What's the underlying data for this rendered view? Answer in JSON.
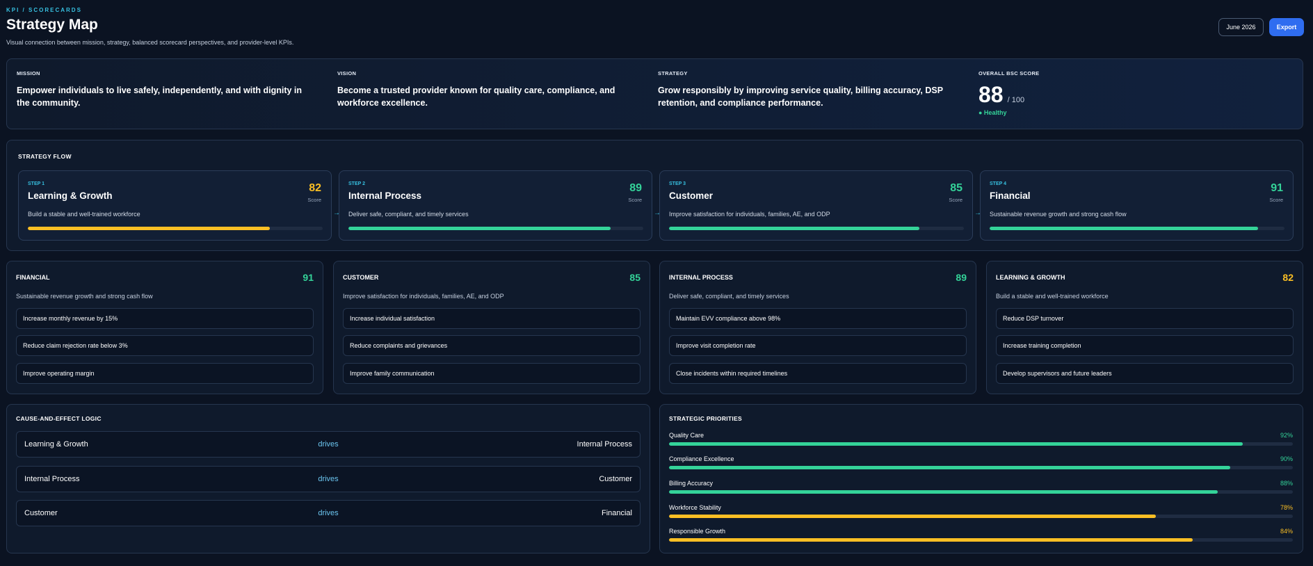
{
  "header": {
    "breadcrumb": "KPI / SCORECARDS",
    "title": "Strategy Map",
    "subtitle": "Visual connection between mission, strategy, balanced scorecard perspectives, and provider-level KPIs.",
    "date_button": "June 2026",
    "export_button": "Export"
  },
  "mission": {
    "mission_label": "MISSION",
    "mission_text": "Empower individuals to live safely, independently, and with dignity in the community.",
    "vision_label": "VISION",
    "vision_text": "Become a trusted provider known for quality care, compliance, and workforce excellence.",
    "strategy_label": "STRATEGY",
    "strategy_text": "Grow responsibly by improving service quality, billing accuracy, DSP retention, and compliance performance.",
    "score_label": "OVERALL BSC SCORE",
    "score_value": "88",
    "score_max": "/ 100",
    "score_status": "● Healthy"
  },
  "flow": {
    "label": "STRATEGY FLOW",
    "steps": [
      {
        "tag": "STEP 1",
        "name": "Learning & Growth",
        "score": "82",
        "score_label": "Score",
        "desc": "Build a stable and well-trained workforce",
        "progress": 0.82,
        "color": "#fbbf24"
      },
      {
        "tag": "STEP 2",
        "name": "Internal Process",
        "score": "89",
        "score_label": "Score",
        "desc": "Deliver safe, compliant, and timely services",
        "progress": 0.89,
        "color": "#34d399"
      },
      {
        "tag": "STEP 3",
        "name": "Customer",
        "score": "85",
        "score_label": "Score",
        "desc": "Improve satisfaction for individuals, families, AE, and ODP",
        "progress": 0.85,
        "color": "#34d399"
      },
      {
        "tag": "STEP 4",
        "name": "Financial",
        "score": "91",
        "score_label": "Score",
        "desc": "Sustainable revenue growth and strong cash flow",
        "progress": 0.91,
        "color": "#34d399"
      }
    ]
  },
  "perspectives": [
    {
      "title": "FINANCIAL",
      "score": "91",
      "color": "#34d399",
      "desc": "Sustainable revenue growth and strong cash flow",
      "objectives": [
        "Increase monthly revenue by 15%",
        "Reduce claim rejection rate below 3%",
        "Improve operating margin"
      ]
    },
    {
      "title": "CUSTOMER",
      "score": "85",
      "color": "#34d399",
      "desc": "Improve satisfaction for individuals, families, AE, and ODP",
      "objectives": [
        "Increase individual satisfaction",
        "Reduce complaints and grievances",
        "Improve family communication"
      ]
    },
    {
      "title": "INTERNAL PROCESS",
      "score": "89",
      "color": "#34d399",
      "desc": "Deliver safe, compliant, and timely services",
      "objectives": [
        "Maintain EVV compliance above 98%",
        "Improve visit completion rate",
        "Close incidents within required timelines"
      ]
    },
    {
      "title": "LEARNING & GROWTH",
      "score": "82",
      "color": "#fbbf24",
      "desc": "Build a stable and well-trained workforce",
      "objectives": [
        "Reduce DSP turnover",
        "Increase training completion",
        "Develop supervisors and future leaders"
      ]
    }
  ],
  "cause_effect": {
    "label": "CAUSE-AND-EFFECT LOGIC",
    "rows": [
      {
        "from": "Learning & Growth",
        "verb": "drives",
        "to": "Internal Process"
      },
      {
        "from": "Internal Process",
        "verb": "drives",
        "to": "Customer"
      },
      {
        "from": "Customer",
        "verb": "drives",
        "to": "Financial"
      }
    ]
  },
  "priorities": {
    "label": "STRATEGIC PRIORITIES",
    "items": [
      {
        "name": "Quality Care",
        "pct": "92%",
        "value": 0.92,
        "color": "#34d399"
      },
      {
        "name": "Compliance Excellence",
        "pct": "90%",
        "value": 0.9,
        "color": "#34d399"
      },
      {
        "name": "Billing Accuracy",
        "pct": "88%",
        "value": 0.88,
        "color": "#34d399"
      },
      {
        "name": "Workforce Stability",
        "pct": "78%",
        "value": 0.78,
        "color": "#fbbf24"
      },
      {
        "name": "Responsible Growth",
        "pct": "84%",
        "value": 0.84,
        "color": "#fbbf24"
      }
    ]
  }
}
